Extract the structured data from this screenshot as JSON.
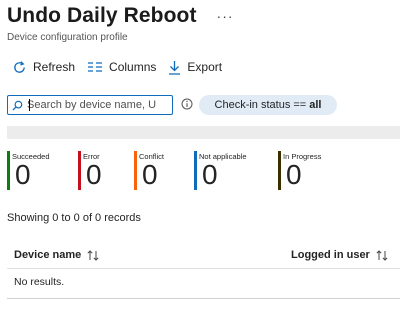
{
  "header": {
    "title": "Undo Daily Reboot",
    "more_label": "···",
    "subtitle": "Device configuration profile"
  },
  "toolbar": {
    "refresh_label": "Refresh",
    "columns_label": "Columns",
    "export_label": "Export"
  },
  "search": {
    "placeholder": "Search by device name, U",
    "value": ""
  },
  "filter": {
    "label": "Check-in status ==",
    "value": "all"
  },
  "tiles": [
    {
      "label": "Succeeded",
      "count": "0",
      "color": "#107c10"
    },
    {
      "label": "Error",
      "count": "0",
      "color": "#c50f1f"
    },
    {
      "label": "Conflict",
      "count": "0",
      "color": "#f7630c"
    },
    {
      "label": "Not applicable",
      "count": "0",
      "color": "#0f6cbd"
    },
    {
      "label": "In Progress",
      "count": "0",
      "color": "#3b2f00"
    }
  ],
  "records_text": "Showing 0 to 0 of 0 records",
  "table": {
    "columns": [
      "Device name",
      "Logged in user"
    ],
    "empty_text": "No results."
  },
  "icons": {
    "refresh": "refresh-icon",
    "columns": "columns-icon",
    "export": "download-icon",
    "search": "search-icon",
    "info": "info-icon",
    "sort": "sort-arrows-icon"
  }
}
